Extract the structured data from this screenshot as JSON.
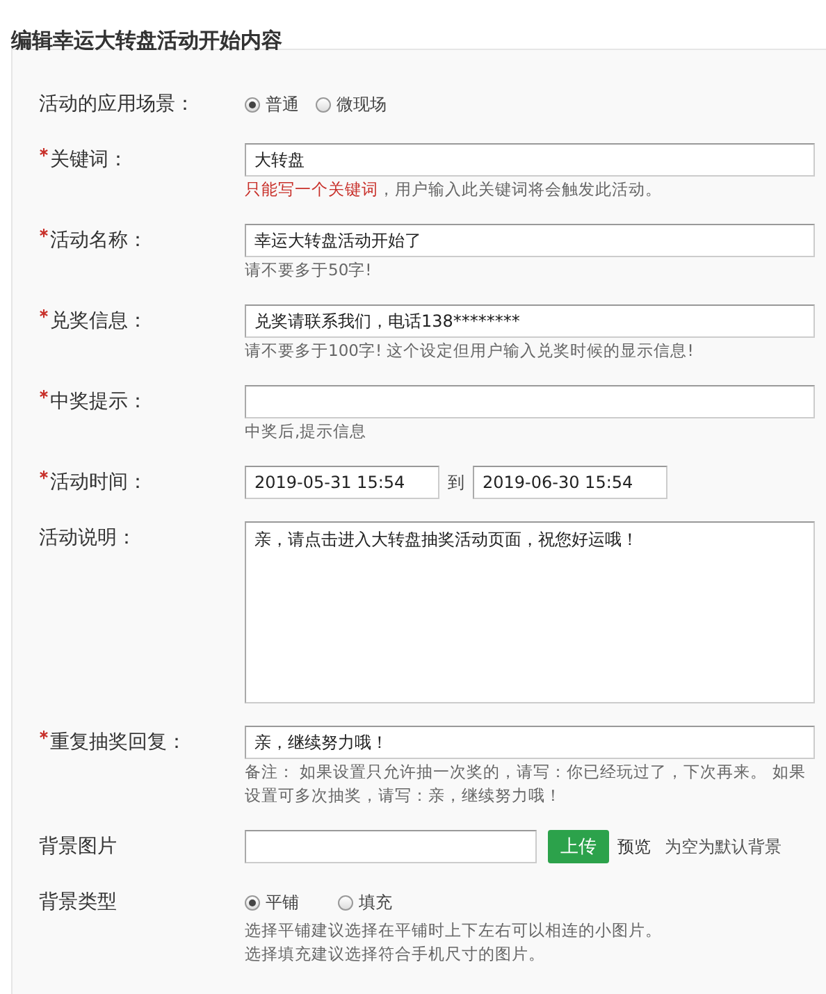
{
  "title": "编辑幸运大转盘活动开始内容",
  "fields": [
    {
      "kind": "radio",
      "label": "活动的应用场景：",
      "required": false,
      "options": [
        {
          "label": "普通",
          "selected": true
        },
        {
          "label": "微现场",
          "selected": false
        }
      ]
    },
    {
      "kind": "text",
      "label": "关键词：",
      "required": true,
      "value": "大转盘",
      "hint_alert": "只能写一个关键词",
      "hint": "，用户输入此关键词将会触发此活动。"
    },
    {
      "kind": "text",
      "label": "活动名称：",
      "required": true,
      "value": "幸运大转盘活动开始了",
      "hint": "请不要多于50字!"
    },
    {
      "kind": "text",
      "label": "兑奖信息：",
      "required": true,
      "value": "兑奖请联系我们，电话138********",
      "hint": "请不要多于100字! 这个设定但用户输入兑奖时候的显示信息!"
    },
    {
      "kind": "text",
      "label": "中奖提示：",
      "required": true,
      "hint": "中奖后,提示信息"
    },
    {
      "kind": "date_range",
      "label": "活动时间：",
      "required": true,
      "start": "2019-05-31 15:54",
      "separator": "到",
      "end": "2019-06-30 15:54"
    },
    {
      "kind": "textarea",
      "label": "活动说明：",
      "required": false,
      "value": "亲，请点击进入大转盘抽奖活动页面，祝您好运哦！"
    },
    {
      "kind": "text",
      "label": "重复抽奖回复：",
      "required": true,
      "value": "亲，继续努力哦！",
      "hint": "备注：  如果设置只允许抽一次奖的，请写：你已经玩过了，下次再来。 如果设置可多次抽奖，请写：亲，继续努力哦！"
    },
    {
      "kind": "upload",
      "label": "背景图片",
      "required": false,
      "button": "上传",
      "link": "预览",
      "note": "为空为默认背景"
    },
    {
      "kind": "radio",
      "label": "背景类型",
      "required": false,
      "options": [
        {
          "label": "平铺",
          "selected": true
        },
        {
          "label": "填充",
          "selected": false
        }
      ],
      "hints": [
        "选择平铺建议选择在平铺时上下左右可以相连的小图片。",
        "选择填充建议选择符合手机尺寸的图片。"
      ]
    }
  ]
}
